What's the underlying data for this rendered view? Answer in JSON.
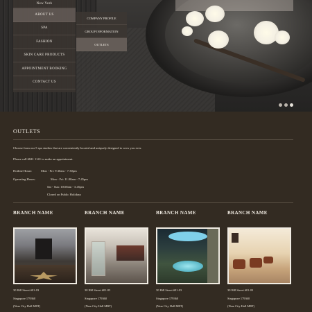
{
  "nav": {
    "top_label": "New York",
    "items": [
      {
        "label": "ABOUT US",
        "active": true
      },
      {
        "label": "SPA",
        "active": false
      },
      {
        "label": "FASHION",
        "active": false
      },
      {
        "label": "SKIN CARE PRODUCTS",
        "active": false
      },
      {
        "label": "APPOINTMENT BOOKING",
        "active": false
      },
      {
        "label": "CONTACT US",
        "active": false
      }
    ],
    "submenu": [
      {
        "label": "COMPANY PROFILE",
        "active": false
      },
      {
        "label": "GROUP INFORMATION",
        "active": false
      },
      {
        "label": "OUTLETS",
        "active": true
      }
    ]
  },
  "slider": {
    "dots": 3,
    "active_index": 2
  },
  "page": {
    "title": "OUTLETS",
    "intro": "Choose from our 5 spa studios that are conveniently located and uniquely designed to wow you ever.",
    "call": "Please call 6841 1141 to make an appointment.",
    "hotline_label": "Hotline Hours:",
    "hotline_value": "Mon - Fri: 9.30am - 7.30pm",
    "operating_label": "Operating Hours:",
    "operating_weekday": "Mon - Fri: 11.00am - 7.45pm",
    "operating_saturday": "Sat - Sun: 10.00am - 3.45pm",
    "operating_holiday": "Closed on Public Holidays"
  },
  "branches": [
    {
      "name": "BRANCH NAME",
      "address1": "30 Hill Street #01-03",
      "address2": "Singapore 179360",
      "address3": "(Near City Hall MRT)"
    },
    {
      "name": "BRANCH NAME",
      "address1": "30 Hill Street #01-03",
      "address2": "Singapore 179360",
      "address3": "(Near City Hall MRT)"
    },
    {
      "name": "BRANCH NAME",
      "address1": "30 Hill Street #01-03",
      "address2": "Singapore 179360",
      "address3": "(Near City Hall MRT)"
    },
    {
      "name": "BRANCH NAME",
      "address1": "30 Hill Street #01-03",
      "address2": "Singapore 179360",
      "address3": "(Near City Hall MRT)"
    }
  ],
  "colors": {
    "background": "#332b22",
    "nav_bg": "#3a3430",
    "text": "#e8e2d6"
  }
}
